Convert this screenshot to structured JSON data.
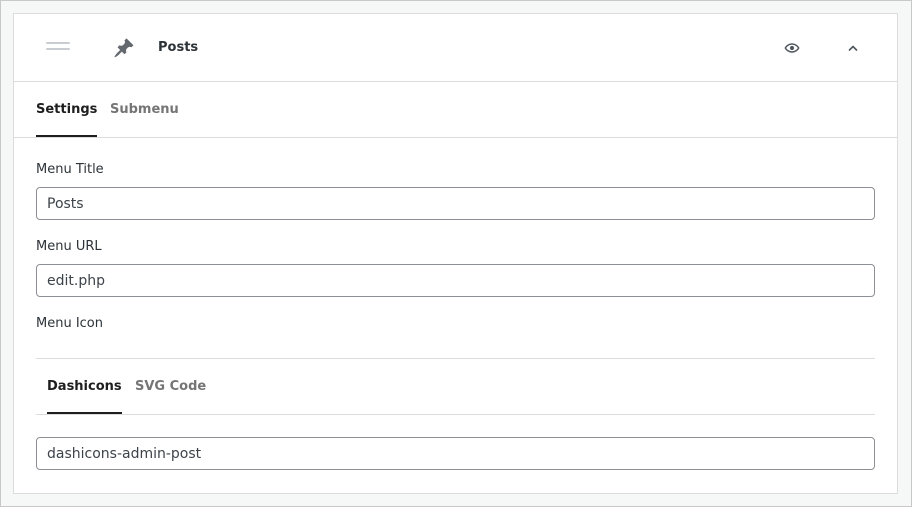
{
  "header": {
    "drag_handle_icon": "drag-handle-icon",
    "item_icon": "pin-icon",
    "title": "Posts",
    "visibility_icon": "eye-icon",
    "collapse_icon": "chevron-up-icon"
  },
  "tabs": [
    {
      "label": "Settings",
      "active": true
    },
    {
      "label": "Submenu",
      "active": false
    }
  ],
  "fields": {
    "menu_title": {
      "label": "Menu Title",
      "value": "Posts"
    },
    "menu_url": {
      "label": "Menu URL",
      "value": "edit.php"
    },
    "menu_icon": {
      "label": "Menu Icon"
    }
  },
  "icon_tabs": [
    {
      "label": "Dashicons",
      "active": true
    },
    {
      "label": "SVG Code",
      "active": false
    }
  ],
  "icon_input": {
    "value": "dashicons-admin-post"
  },
  "colors": {
    "active_tab": "#1e1e1e",
    "inactive_tab": "#757575",
    "border": "#dcdcde",
    "input_border": "#8c8f94"
  }
}
